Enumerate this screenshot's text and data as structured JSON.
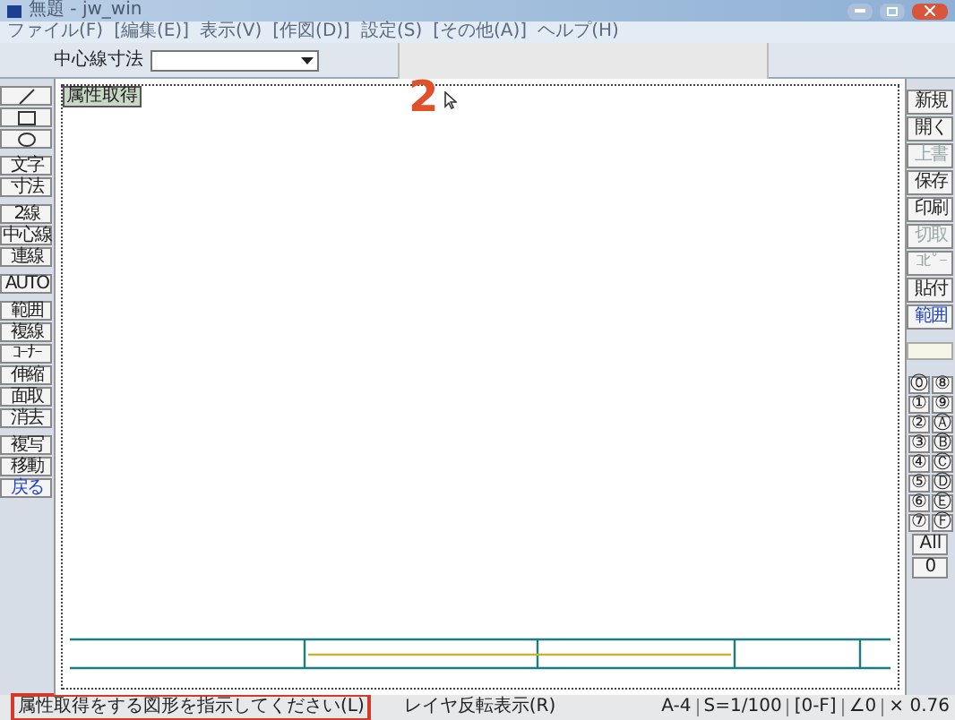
{
  "window": {
    "title": "無題 - jw_win"
  },
  "menu": [
    "ファイル(F)",
    "[編集(E)]",
    "表示(V)",
    "[作図(D)]",
    "設定(S)",
    "[その他(A)]",
    "ヘルプ(H)"
  ],
  "toolbar": {
    "label": "中心線寸法"
  },
  "left_tool_groups": [
    [
      {
        "kind": "line"
      },
      {
        "kind": "rect"
      },
      {
        "kind": "circle"
      }
    ],
    [
      {
        "kind": "text",
        "label": "文字"
      },
      {
        "kind": "text",
        "label": "寸法"
      }
    ],
    [
      {
        "kind": "text",
        "label": "2線"
      },
      {
        "kind": "text",
        "label": "中心線"
      },
      {
        "kind": "text",
        "label": "連線"
      }
    ],
    [
      {
        "kind": "text",
        "label": "AUTO"
      }
    ],
    [
      {
        "kind": "text",
        "label": "範囲"
      },
      {
        "kind": "text",
        "label": "複線"
      },
      {
        "kind": "text",
        "label": "ｺｰﾅｰ"
      },
      {
        "kind": "text",
        "label": "伸縮"
      },
      {
        "kind": "text",
        "label": "面取"
      },
      {
        "kind": "text",
        "label": "消去"
      }
    ],
    [
      {
        "kind": "text",
        "label": "複写"
      },
      {
        "kind": "text",
        "label": "移動"
      },
      {
        "kind": "text",
        "label": "戻る",
        "accent": true
      }
    ]
  ],
  "right_tools": [
    {
      "label": "新規",
      "disabled": false
    },
    {
      "label": "開く",
      "disabled": false
    },
    {
      "label": "上書",
      "disabled": true
    },
    {
      "label": "保存",
      "disabled": false
    },
    {
      "label": "印刷",
      "disabled": false
    },
    {
      "label": "切取",
      "disabled": true
    },
    {
      "label": "ｺﾋﾟｰ",
      "disabled": true
    },
    {
      "label": "貼付",
      "disabled": false
    },
    {
      "label": "範囲",
      "disabled": false,
      "accent": true
    }
  ],
  "layers": [
    [
      "⓪",
      "⑧"
    ],
    [
      "①",
      "⑨"
    ],
    [
      "②",
      "Ⓐ"
    ],
    [
      "③",
      "Ⓑ"
    ],
    [
      "④",
      "Ⓒ"
    ],
    [
      "⑤",
      "Ⓓ"
    ],
    [
      "⑥",
      "Ⓔ"
    ],
    [
      "⑦",
      "Ⓕ"
    ]
  ],
  "layer_buttons": [
    "All",
    "0"
  ],
  "canvas": {
    "mode_label": "属性取得",
    "step_marker": "2"
  },
  "status_bar": {
    "message": "属性取得をする図形を指示してください(L)",
    "hint": "レイヤ反転表示(R)",
    "paper": "A-4",
    "scale": "S=1/100",
    "layer_group": "[0-F]",
    "angle": "∠0",
    "zoom": "× 0.76"
  }
}
